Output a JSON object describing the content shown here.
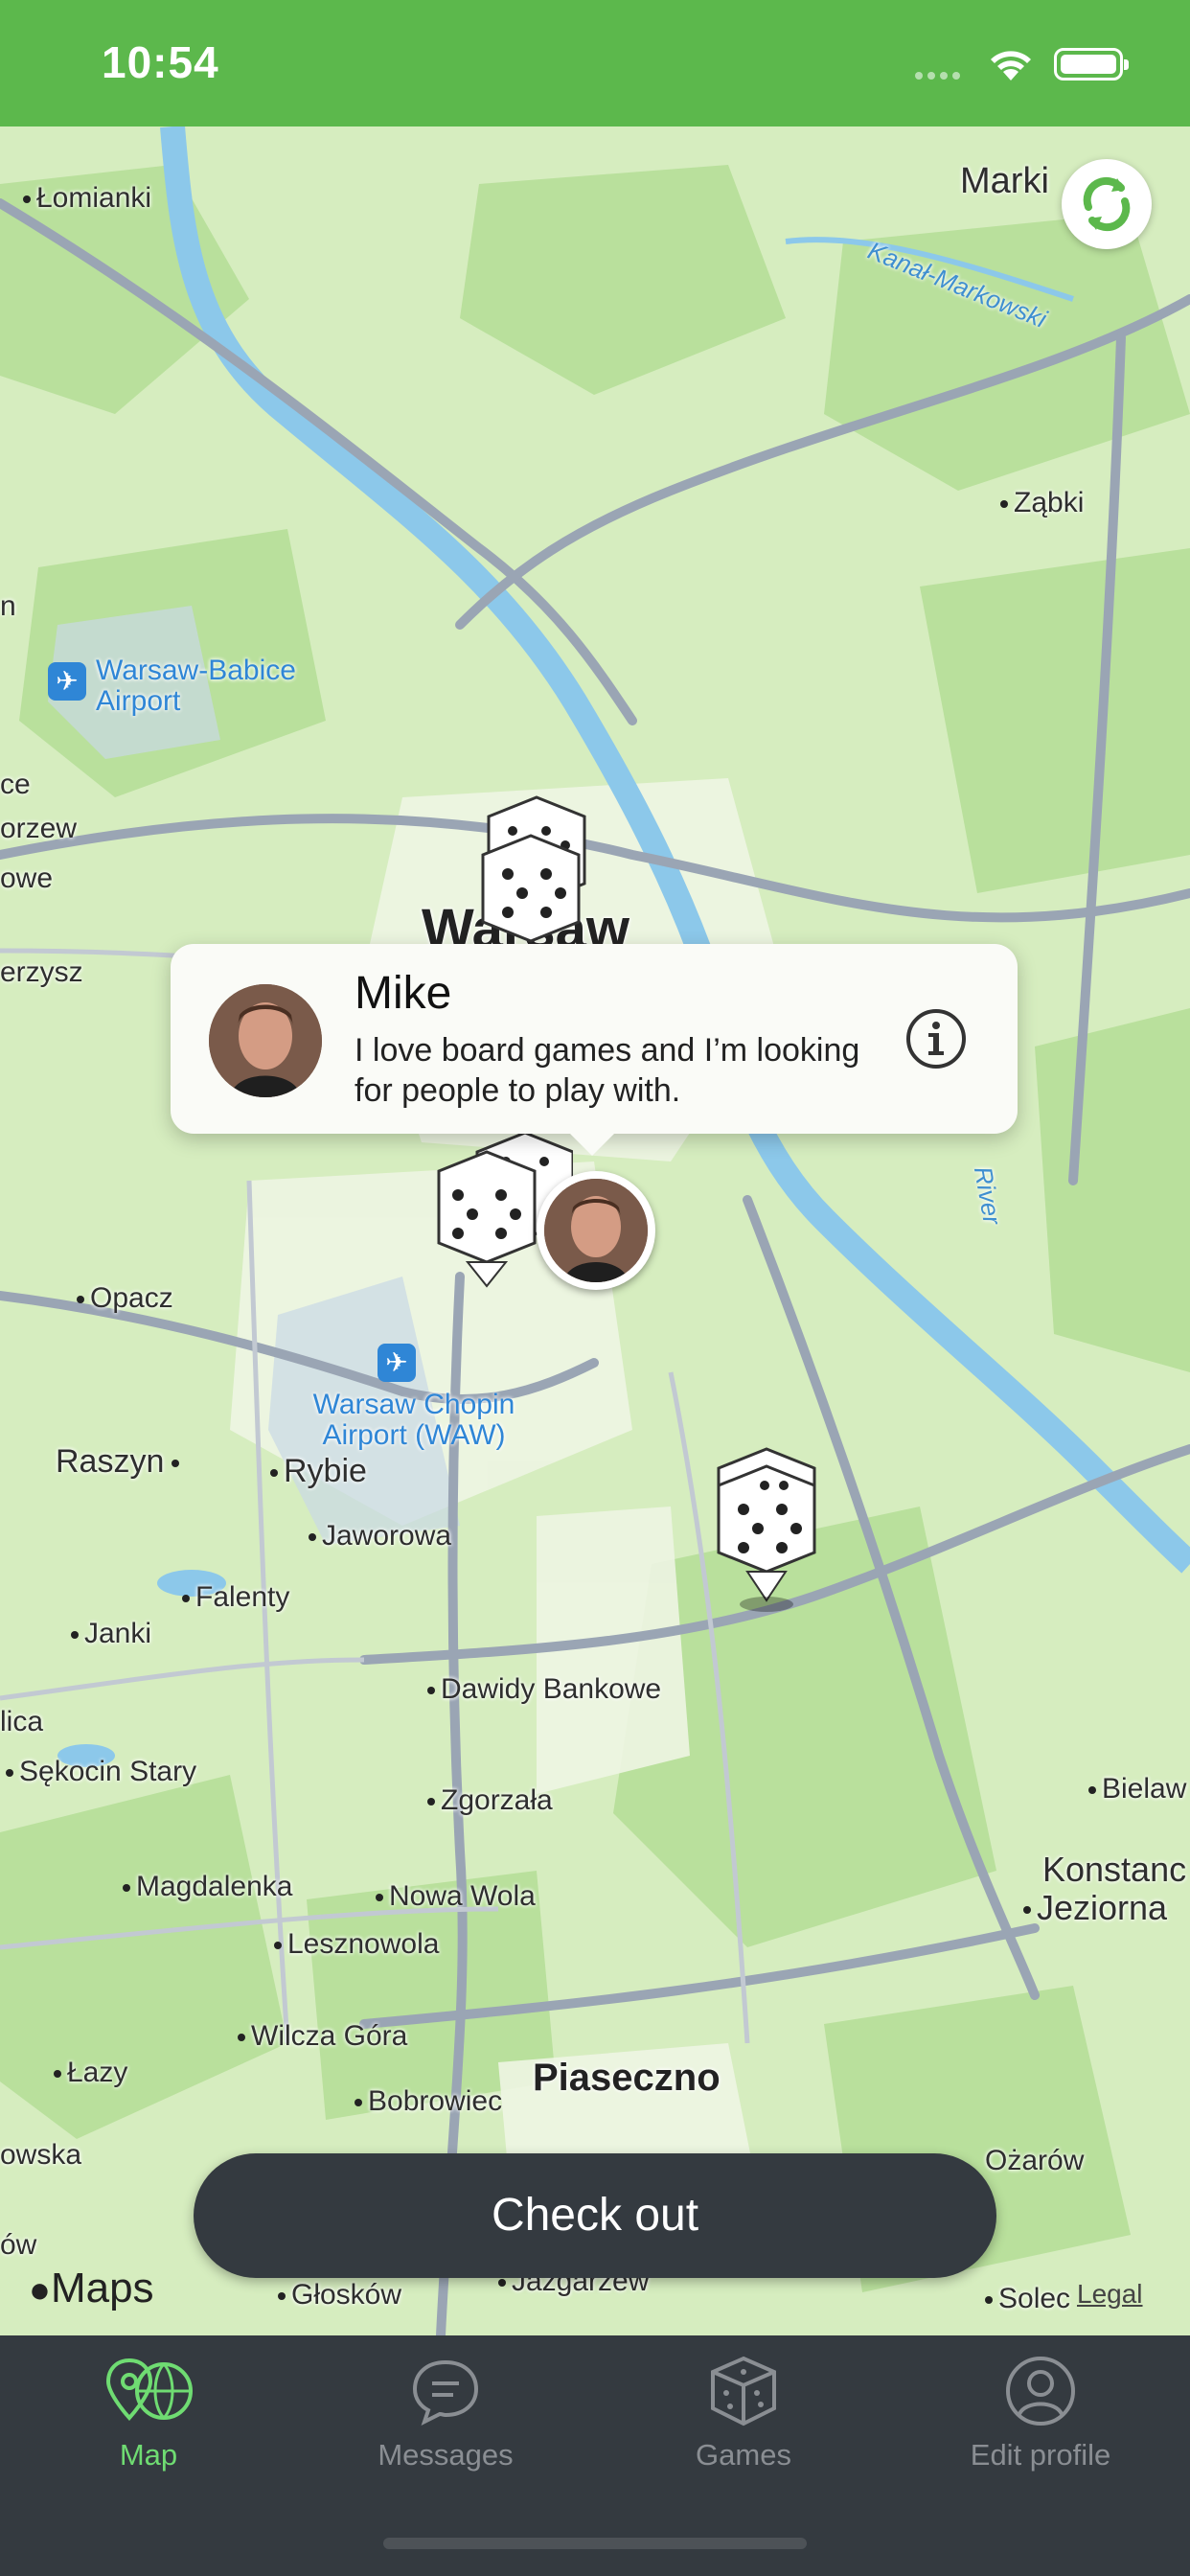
{
  "status_bar": {
    "time": "10:54"
  },
  "map": {
    "places": {
      "lomianki": "Łomianki",
      "marki": "Marki",
      "kanal": "Kanał-Markowski",
      "zabki": "Ząbki",
      "babice": "Warsaw-Babice Airport",
      "warsaw": "Warsaw",
      "opacz": "Opacz",
      "chopin": "Warsaw Chopin Airport (WAW)",
      "raszyn": "Raszyn",
      "rybie": "Rybie",
      "jaworowa": "Jaworowa",
      "falenty": "Falenty",
      "janki": "Janki",
      "dawidy": "Dawidy Bankowe",
      "sekocin": "Sękocin Stary",
      "zgorzala": "Zgorzała",
      "magdalenka": "Magdalenka",
      "nowa_wola": "Nowa Wola",
      "lesznowola": "Lesznowola",
      "wilcza": "Wilcza Góra",
      "lazy": "Łazy",
      "bobrowiec": "Bobrowiec",
      "piaseczno": "Piaseczno",
      "konstancin_1": "Konstanc",
      "konstancin_2": "Jeziorna",
      "bielawa": "Bielaw",
      "river": "River",
      "glosków": "Głosków",
      "jazgarzew": "Jazgarzew",
      "solec": "Solec",
      "ozarow": "Ożarów",
      "left_1": "n",
      "left_2": "ce",
      "left_3": "orzew",
      "left_4": "owe",
      "left_5": "erzysz",
      "left_6": "lica",
      "left_7": "owska",
      "left_8": "ów"
    },
    "maps_label": "Maps",
    "legal_label": "Legal",
    "refresh_icon": "refresh-icon",
    "pins": [
      {
        "type": "dice",
        "label": "game-pin"
      },
      {
        "type": "dice",
        "label": "game-pin"
      },
      {
        "type": "user",
        "label": "user-pin"
      }
    ]
  },
  "callout": {
    "name": "Mike",
    "message": "I love board games and I’m looking for people to play with.",
    "info_icon": "info-icon"
  },
  "checkout_button": "Check out",
  "tabs": [
    {
      "label": "Map",
      "icon": "map-pin-globe-icon",
      "active": true
    },
    {
      "label": "Messages",
      "icon": "chat-bubble-icon",
      "active": false
    },
    {
      "label": "Games",
      "icon": "dice-icon",
      "active": false
    },
    {
      "label": "Edit profile",
      "icon": "person-circle-icon",
      "active": false
    }
  ],
  "colors": {
    "accent": "#5cb84c",
    "tab_active": "#6fdc72",
    "dark": "#343a40"
  }
}
